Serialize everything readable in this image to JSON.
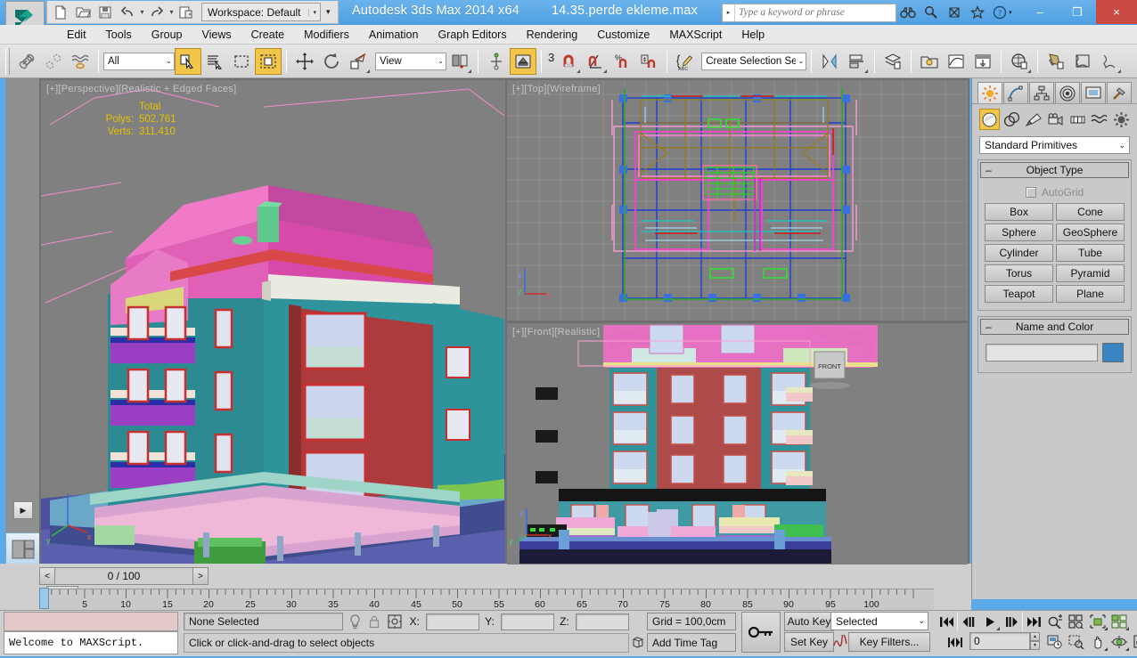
{
  "window": {
    "app_title": "Autodesk 3ds Max  2014 x64",
    "file_title": "14.35.perde ekleme.max",
    "minimize": "–",
    "maximize": "❐",
    "close": "×"
  },
  "quick_access": {
    "workspace_label": "Workspace: Default",
    "items": [
      {
        "name": "new-file-icon",
        "label": "New"
      },
      {
        "name": "open-file-icon",
        "label": "Open"
      },
      {
        "name": "save-file-icon",
        "label": "Save"
      },
      {
        "name": "undo-icon",
        "label": "Undo"
      },
      {
        "name": "redo-icon",
        "label": "Redo"
      },
      {
        "name": "project-folder-icon",
        "label": "Set Project Folder"
      }
    ],
    "more_arrow": "▾"
  },
  "search": {
    "placeholder": "Type a keyword or phrase",
    "value": "",
    "caret": "▸",
    "icons": [
      "binoculars-icon",
      "key-search-icon",
      "subscription-icon",
      "favorites-star-icon",
      "help-icon"
    ],
    "help_arrow": "▾"
  },
  "menu": {
    "items": [
      "Edit",
      "Tools",
      "Group",
      "Views",
      "Create",
      "Modifiers",
      "Animation",
      "Graph Editors",
      "Rendering",
      "Customize",
      "MAXScript",
      "Help"
    ]
  },
  "toolbar": {
    "selection_filter": "All",
    "reference_coordinate": "View",
    "named_selection_set": "Create Selection Se",
    "snap_count": "3",
    "buttons": [
      {
        "name": "select-and-link-icon",
        "label": "Select and Link"
      },
      {
        "name": "unlink-selection-icon",
        "label": "Unlink Selection"
      },
      {
        "name": "bind-to-space-warp-icon",
        "label": "Bind to Space Warp"
      },
      {
        "name": "select-object-icon",
        "label": "Select Object",
        "active": true
      },
      {
        "name": "select-by-name-icon",
        "label": "Select by Name"
      },
      {
        "name": "rectangular-selection-region-icon",
        "label": "Rectangular Selection Region"
      },
      {
        "name": "window-crossing-icon",
        "label": "Window/Crossing",
        "active": true
      },
      {
        "name": "select-and-move-icon",
        "label": "Select and Move"
      },
      {
        "name": "select-and-rotate-icon",
        "label": "Select and Rotate"
      },
      {
        "name": "select-and-scale-icon",
        "label": "Select and Uniform Scale"
      },
      {
        "name": "use-center-flyout-icon",
        "label": "Use Pivot Point Center"
      },
      {
        "name": "select-and-manipulate-icon",
        "label": "Select and Manipulate"
      },
      {
        "name": "keyboard-shortcut-override-icon",
        "label": "Keyboard Shortcut Override Toggle",
        "active": true
      },
      {
        "name": "snaps-toggle-icon",
        "label": "Snaps Toggle"
      },
      {
        "name": "angle-snap-toggle-icon",
        "label": "Angle Snap Toggle"
      },
      {
        "name": "percent-snap-toggle-icon",
        "label": "Percent Snap Toggle"
      },
      {
        "name": "spinner-snap-toggle-icon",
        "label": "Spinner Snap Toggle"
      },
      {
        "name": "edit-named-selection-sets-icon",
        "label": "Edit Named Selection Sets"
      },
      {
        "name": "mirror-icon",
        "label": "Mirror"
      },
      {
        "name": "align-icon",
        "label": "Align"
      },
      {
        "name": "layer-manager-icon",
        "label": "Layer Manager"
      },
      {
        "name": "scene-explorer-icon",
        "label": "Scene Explorer"
      },
      {
        "name": "curve-editor-icon",
        "label": "Curve Editor"
      },
      {
        "name": "schematic-view-icon",
        "label": "Schematic View"
      },
      {
        "name": "material-editor-icon",
        "label": "Material Editor"
      },
      {
        "name": "render-setup-icon",
        "label": "Render Setup"
      },
      {
        "name": "rendered-frame-window-icon",
        "label": "Rendered Frame Window"
      },
      {
        "name": "render-production-icon",
        "label": "Render Production"
      }
    ]
  },
  "viewports": [
    {
      "name": "perspective-viewport",
      "label": "[+][Perspective][Realistic + Edged Faces]",
      "active": false,
      "stats": {
        "header": "Total",
        "rows": [
          {
            "label": "Polys:",
            "value": "502.761"
          },
          {
            "label": "Verts:",
            "value": "311.410"
          }
        ]
      },
      "axis": {
        "x": "x",
        "y": "y",
        "z": "z"
      }
    },
    {
      "name": "top-viewport",
      "label": "[+][Top][Wireframe]",
      "active": false,
      "axis": {
        "x": "x",
        "y": "y",
        "z": "z"
      }
    },
    {
      "name": "front-viewport",
      "label": "[+][Front][Realistic]",
      "active": true,
      "viewcube_label": "FRONT",
      "axis": {
        "x": "x",
        "y": "y",
        "z": "z"
      }
    }
  ],
  "command_panel": {
    "tabs": [
      {
        "name": "create-tab",
        "icon": "sun-icon",
        "active": true
      },
      {
        "name": "modify-tab",
        "icon": "curve-icon",
        "active": false
      },
      {
        "name": "hierarchy-tab",
        "icon": "hierarchy-icon",
        "active": false
      },
      {
        "name": "motion-tab",
        "icon": "motion-icon",
        "active": false
      },
      {
        "name": "display-tab",
        "icon": "display-icon",
        "active": false
      },
      {
        "name": "utilities-tab",
        "icon": "hammer-icon",
        "active": false
      }
    ],
    "category_buttons": [
      {
        "name": "geometry-category-icon",
        "label": "Geometry",
        "active": true
      },
      {
        "name": "shapes-category-icon",
        "label": "Shapes",
        "active": false
      },
      {
        "name": "lights-category-icon",
        "label": "Lights",
        "active": false
      },
      {
        "name": "cameras-category-icon",
        "label": "Cameras",
        "active": false
      },
      {
        "name": "helpers-category-icon",
        "label": "Helpers",
        "active": false
      },
      {
        "name": "space-warps-category-icon",
        "label": "Space Warps",
        "active": false
      },
      {
        "name": "systems-category-icon",
        "label": "Systems",
        "active": false
      }
    ],
    "subcategory": "Standard Primitives",
    "subcategory_arrow": "⌄",
    "object_type": {
      "title": "Object Type",
      "collapse": "–",
      "autogrid_label": "AutoGrid",
      "autogrid_checked": false,
      "buttons": [
        "Box",
        "Cone",
        "Sphere",
        "GeoSphere",
        "Cylinder",
        "Tube",
        "Torus",
        "Pyramid",
        "Teapot",
        "Plane"
      ]
    },
    "name_and_color": {
      "title": "Name and Color",
      "collapse": "–",
      "name_value": "",
      "color": "#3a84c4"
    }
  },
  "timeline": {
    "current_frame_display": "0 / 100",
    "prev_arrow": "<",
    "next_arrow": ">",
    "range_start": 0,
    "range_end": 100,
    "tick_labels": [
      0,
      5,
      10,
      15,
      20,
      25,
      30,
      35,
      40,
      45,
      50,
      55,
      60,
      65,
      70,
      75,
      80,
      85,
      90,
      95,
      100
    ],
    "slider_position": 0
  },
  "status_bar": {
    "maxscript_prompt": "Welcome to MAXScript.",
    "selection_status": "None Selected",
    "prompt_line": "Click or click-and-drag to select objects",
    "coords": {
      "x_label": "X:",
      "x_value": "",
      "y_label": "Y:",
      "y_value": "",
      "z_label": "Z:",
      "z_value": ""
    },
    "grid_text": "Grid = 100,0cm",
    "add_time_tag": "Add Time Tag",
    "icons": [
      "isolate-selection-icon",
      "selection-lock-icon",
      "absolute-relative-transform-icon",
      "adaptive-degradation-icon"
    ]
  },
  "animation_controls": {
    "key_mode_icon": "key-icon",
    "auto_key": "Auto Key",
    "set_key": "Set Key",
    "key_filters": "Key Filters...",
    "key_mode_selection": "Selected",
    "key_mode_arrow": "⌄",
    "curve_icon": "set-key-curve-icon",
    "frame_value": "0",
    "playback": [
      {
        "name": "goto-start-button",
        "glyph": "┃◀◀"
      },
      {
        "name": "previous-frame-button",
        "glyph": "◀┃┃"
      },
      {
        "name": "play-animation-button",
        "glyph": "▶"
      },
      {
        "name": "next-frame-button",
        "glyph": "┃┃▶"
      },
      {
        "name": "goto-end-button",
        "glyph": "▶▶┃"
      }
    ],
    "nav_icons": [
      "zoom-icon",
      "zoom-all-icon",
      "zoom-extents-icon",
      "zoom-extents-all-icon",
      "time-configuration-icon",
      "zoom-region-icon",
      "pan-view-icon",
      "orbit-icon",
      "maximize-viewport-toggle-icon"
    ]
  },
  "left_rail": {
    "expand_arrow": "▶",
    "layout_buttons": [
      {
        "name": "layout-tab-1",
        "active": true
      },
      {
        "name": "layout-tab-2",
        "active": false
      }
    ]
  },
  "colors": {
    "window_frame": "#5aa9e8",
    "toolbar_bg": "#dcdcdc",
    "panel_bg": "#c9c9c9",
    "viewport_bg": "#808080",
    "active_viewport_border": "#ffe600",
    "accent_yellow": "#f3c64b",
    "stats_text": "#e6c200"
  }
}
